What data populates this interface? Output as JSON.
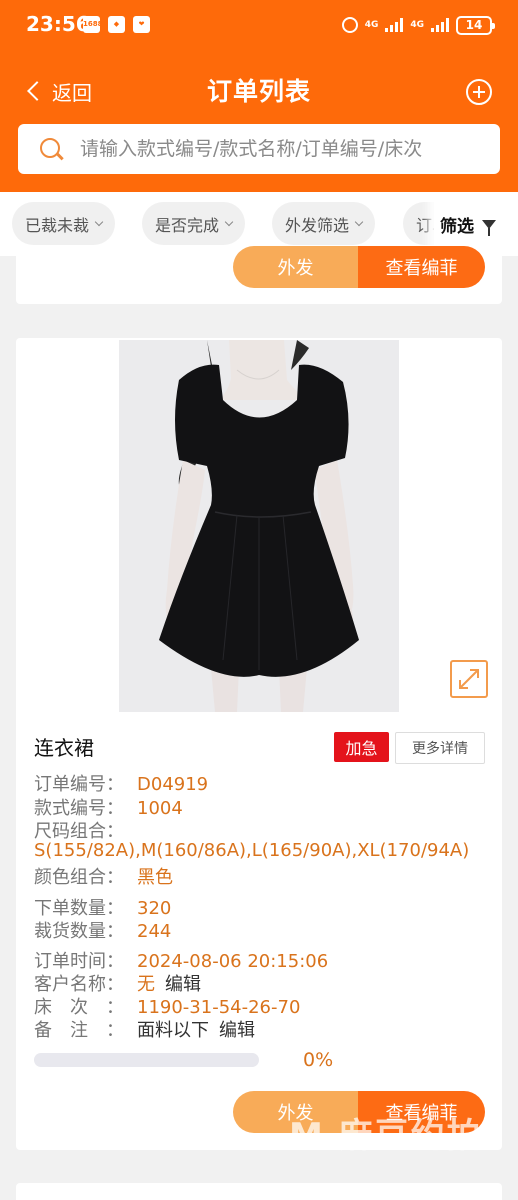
{
  "status_bar": {
    "time": "23:56",
    "app_badges": [
      "1688"
    ],
    "network_1": "4G",
    "network_2": "4G",
    "battery": "14"
  },
  "nav": {
    "back_label": "返回",
    "title": "订单列表"
  },
  "search": {
    "placeholder": "请输入款式编号/款式名称/订单编号/床次"
  },
  "filters": {
    "chips": [
      "已裁未裁",
      "是否完成",
      "外发筛选",
      "订单"
    ],
    "filter_label": "筛选"
  },
  "prev_card": {
    "outsource_label": "外发",
    "view_label": "查看编菲"
  },
  "order": {
    "name": "连衣裙",
    "urgent_badge": "加急",
    "more_label": "更多详情",
    "order_no_label": "订单编号：",
    "order_no": "D04919",
    "style_no_label": "款式编号：",
    "style_no": "1004",
    "size_label": "尺码组合：",
    "sizes": "S(155/82A),M(160/86A),L(165/90A),XL(170/94A)",
    "color_label": "颜色组合：",
    "color": "黑色",
    "qty_label": "下单数量：",
    "qty": "320",
    "cut_label": "裁货数量：",
    "cut": "244",
    "time_label": "订单时间：",
    "time": "2024-08-06 20:15:06",
    "customer_label": "客户名称：",
    "customer": "无",
    "customer_edit": "编辑",
    "bed_label": "床　次　：",
    "bed": "1190-31-54-26-70",
    "note_label": "备　注　：",
    "note": "面料以下",
    "note_edit": "编辑",
    "progress_percent": 0,
    "progress_text": "0%",
    "outsource_label": "外发",
    "view_label": "查看编菲"
  },
  "watermark": "M 麻豆约拍",
  "colors": {
    "brand": "#fe6a0a",
    "button_light": "#f8ab58",
    "button_dark": "#fd6b14",
    "value_text": "#d9731c",
    "urgent": "#e4131b"
  }
}
